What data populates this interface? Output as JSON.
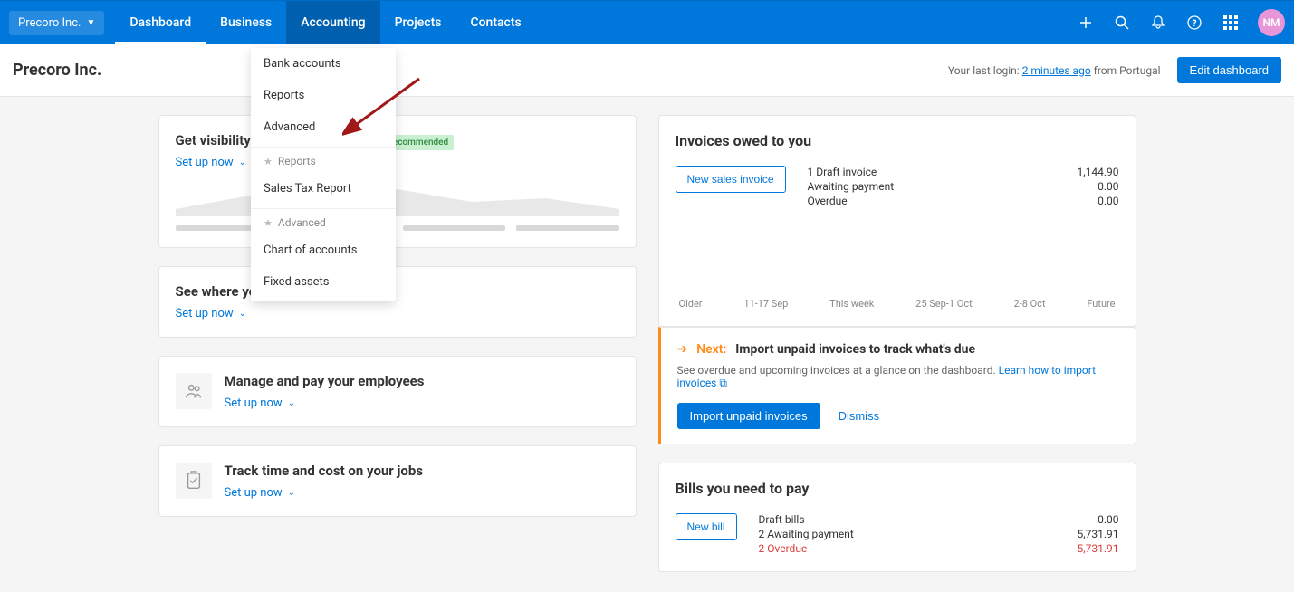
{
  "topbar": {
    "org": "Precoro Inc.",
    "tabs": [
      "Dashboard",
      "Business",
      "Accounting",
      "Projects",
      "Contacts"
    ],
    "avatar": "NM"
  },
  "subhead": {
    "title": "Precoro Inc.",
    "login_prefix": "Your last login: ",
    "login_link": "2 minutes ago",
    "login_suffix": " from Portugal",
    "edit_btn": "Edit dashboard"
  },
  "dropdown": {
    "items_top": [
      "Bank accounts",
      "Reports",
      "Advanced"
    ],
    "section_reports": "Reports",
    "items_reports": [
      "Sales Tax Report"
    ],
    "section_advanced": "Advanced",
    "items_advanced": [
      "Chart of accounts",
      "Fixed assets"
    ]
  },
  "cards": {
    "cashflow": {
      "title": "Get visibility over your cash flow",
      "setup": "Set up now",
      "badge": "Recommended"
    },
    "money": {
      "title": "See where your money is going",
      "setup": "Set up now"
    },
    "employees": {
      "title": "Manage and pay your employees",
      "setup": "Set up now"
    },
    "time": {
      "title": "Track time and cost on your jobs",
      "setup": "Set up now"
    }
  },
  "invoices": {
    "title": "Invoices owed to you",
    "new_btn": "New sales invoice",
    "stats": [
      {
        "label": "1 Draft invoice",
        "value": "1,144.90"
      },
      {
        "label": "Awaiting payment",
        "value": "0.00"
      },
      {
        "label": "Overdue",
        "value": "0.00"
      }
    ],
    "axis": [
      "Older",
      "11-17 Sep",
      "This week",
      "25 Sep-1 Oct",
      "2-8 Oct",
      "Future"
    ]
  },
  "next": {
    "label": "Next:",
    "title": "Import unpaid invoices to track what's due",
    "desc": "See overdue and upcoming invoices at a glance on the dashboard. ",
    "learn": "Learn how to import invoices",
    "import_btn": "Import unpaid invoices",
    "dismiss": "Dismiss"
  },
  "bills": {
    "title": "Bills you need to pay",
    "new_btn": "New bill",
    "stats": [
      {
        "label": "Draft bills",
        "value": "0.00",
        "overdue": false
      },
      {
        "label": "2 Awaiting payment",
        "value": "5,731.91",
        "overdue": false
      },
      {
        "label": "2 Overdue",
        "value": "5,731.91",
        "overdue": true
      }
    ]
  }
}
